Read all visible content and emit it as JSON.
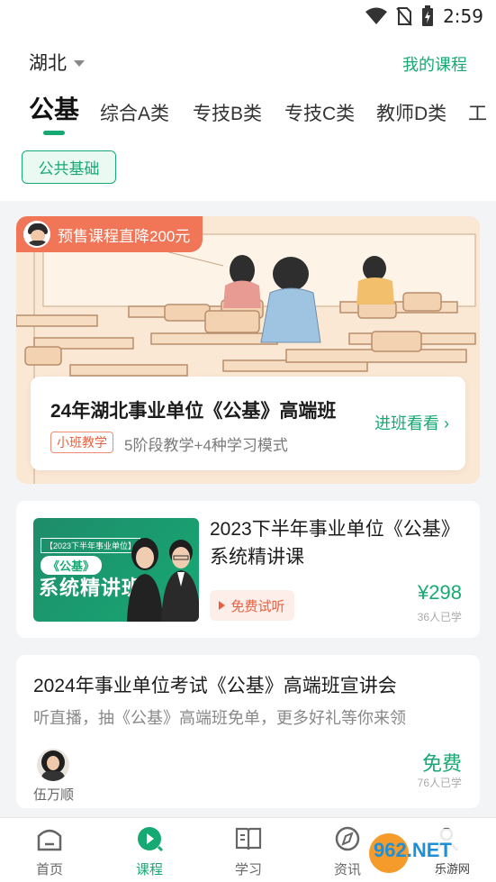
{
  "status_bar": {
    "time": "2:59"
  },
  "header": {
    "region": "湖北",
    "my_courses": "我的课程",
    "tabs": [
      "公基",
      "综合A类",
      "专技B类",
      "专技C类",
      "教师D类",
      "工"
    ],
    "chip": "公共基础"
  },
  "banner": {
    "promo": "预售课程直降200元",
    "title": "24年湖北事业单位《公基》高端班",
    "tag": "小班教学",
    "subtitle": "5阶段教学+4种学习模式",
    "link": "进班看看 ›"
  },
  "course_card": {
    "thumb_top": "【2023下半年事业单位】",
    "thumb_pill": "《公基》",
    "thumb_big": "系统精讲班",
    "title": "2023下半年事业单位《公基》系统精讲课",
    "free_trial": "免费试听",
    "price": "¥298",
    "learners": "36人已学"
  },
  "live_card": {
    "title": "2024年事业单位考试《公基》高端班宣讲会",
    "desc": "听直播，抽《公基》高端班免单，更多好礼等你来领",
    "teacher": "伍万顺",
    "price": "免费",
    "learners": "76人已学"
  },
  "bottom_nav": {
    "items": [
      "首页",
      "课程",
      "学习",
      "资讯",
      "我的"
    ],
    "active": "课程"
  },
  "watermark": {
    "text": "962.NET",
    "sub": "乐游网"
  },
  "colors": {
    "accent": "#17a974",
    "promo": "#f07657",
    "banner_bg": "#fbe8d4"
  }
}
